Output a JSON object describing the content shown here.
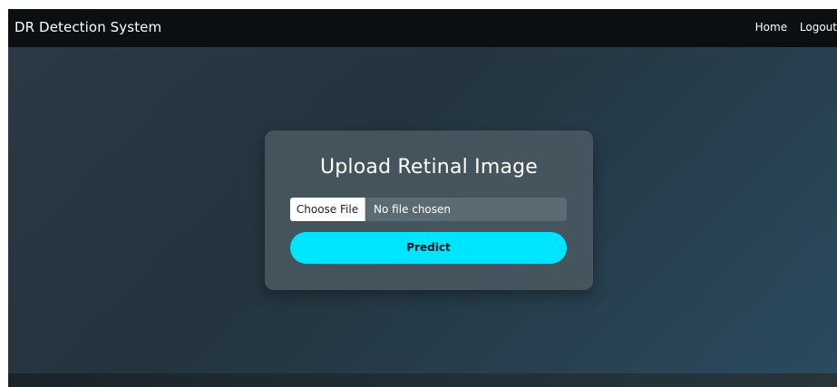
{
  "navbar": {
    "brand": "DR Detection System",
    "links": [
      "Home",
      "Logout"
    ]
  },
  "upload_card": {
    "title": "Upload Retinal Image",
    "file_button_label": "Choose File",
    "file_status": "No file chosen",
    "predict_label": "Predict"
  },
  "colors": {
    "navbar_bg": "#0b0f12",
    "accent": "#00e5ff"
  }
}
